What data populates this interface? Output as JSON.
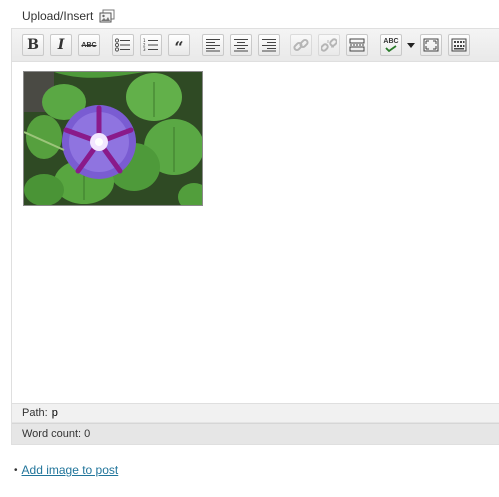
{
  "upload": {
    "label": "Upload/Insert",
    "icon": "media-gallery-icon"
  },
  "toolbar": {
    "bold_label": "B",
    "italic_label": "I",
    "strikethrough_label": "ABC",
    "blockquote_label": "“",
    "spellcheck_label": "ABC",
    "buttons": [
      "bold-button",
      "italic-button",
      "strikethrough-button",
      "unordered-list-button",
      "ordered-list-button",
      "blockquote-button",
      "align-left-button",
      "align-center-button",
      "align-right-button",
      "insert-link-button",
      "unlink-button",
      "more-tag-button",
      "spellcheck-button",
      "language-dropdown",
      "fullscreen-button",
      "kitchen-sink-button"
    ]
  },
  "status": {
    "path_label": "Path:",
    "path_value": "p",
    "word_count": "Word count: 0"
  },
  "footer": {
    "bullet": "•",
    "add_image_link": "Add image to post"
  },
  "colors": {
    "link": "#21759b",
    "toolbar_bg": "#eeeeee",
    "statusbar_bg": "#e6e6e6"
  }
}
